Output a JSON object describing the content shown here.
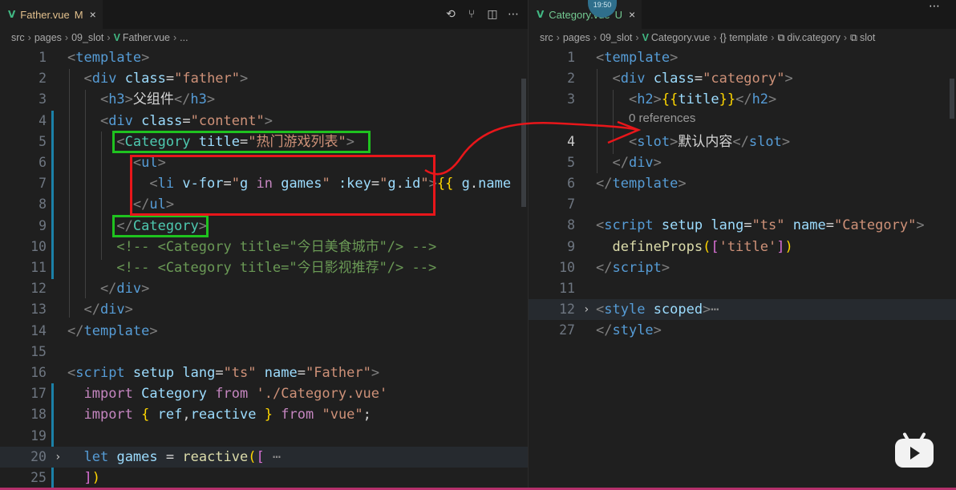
{
  "left": {
    "tab": {
      "label": "Father.vue",
      "status": "M",
      "close": "×"
    },
    "breadcrumb": [
      "src",
      "pages",
      "09_slot",
      "Father.vue",
      "..."
    ],
    "line_numbers": [
      "1",
      "2",
      "3",
      "4",
      "5",
      "6",
      "7",
      "8",
      "9",
      "10",
      "11",
      "12",
      "13",
      "14",
      "15",
      "16",
      "17",
      "18",
      "19",
      "20",
      "25"
    ],
    "lines": [
      [
        [
          "t-p",
          "<"
        ],
        [
          "t-tag",
          "template"
        ],
        [
          "t-p",
          ">"
        ]
      ],
      [
        [
          "t-p",
          "  <"
        ],
        [
          "t-tag",
          "div"
        ],
        [
          "t-txt",
          " "
        ],
        [
          "t-attr",
          "class"
        ],
        [
          "t-txt",
          "="
        ],
        [
          "t-str",
          "\"father\""
        ],
        [
          "t-p",
          ">"
        ]
      ],
      [
        [
          "t-p",
          "    <"
        ],
        [
          "t-tag",
          "h3"
        ],
        [
          "t-p",
          ">"
        ],
        [
          "t-txt",
          "父组件"
        ],
        [
          "t-p",
          "</"
        ],
        [
          "t-tag",
          "h3"
        ],
        [
          "t-p",
          ">"
        ]
      ],
      [
        [
          "t-p",
          "    <"
        ],
        [
          "t-tag",
          "div"
        ],
        [
          "t-txt",
          " "
        ],
        [
          "t-attr",
          "class"
        ],
        [
          "t-txt",
          "="
        ],
        [
          "t-str",
          "\"content\""
        ],
        [
          "t-p",
          ">"
        ]
      ],
      [
        [
          "t-p",
          "      <"
        ],
        [
          "t-cls",
          "Category"
        ],
        [
          "t-txt",
          " "
        ],
        [
          "t-attr",
          "title"
        ],
        [
          "t-txt",
          "="
        ],
        [
          "t-str",
          "\"热门游戏列表\""
        ],
        [
          "t-p",
          ">"
        ]
      ],
      [
        [
          "t-p",
          "        <"
        ],
        [
          "t-tag",
          "ul"
        ],
        [
          "t-p",
          ">"
        ]
      ],
      [
        [
          "t-p",
          "          <"
        ],
        [
          "t-tag",
          "li"
        ],
        [
          "t-txt",
          " "
        ],
        [
          "t-attr",
          "v-for"
        ],
        [
          "t-txt",
          "="
        ],
        [
          "t-str",
          "\""
        ],
        [
          "t-var",
          "g"
        ],
        [
          "t-txt",
          " "
        ],
        [
          "t-kw",
          "in"
        ],
        [
          "t-txt",
          " "
        ],
        [
          "t-var",
          "games"
        ],
        [
          "t-str",
          "\""
        ],
        [
          "t-txt",
          " "
        ],
        [
          "t-attr",
          ":key"
        ],
        [
          "t-txt",
          "="
        ],
        [
          "t-str",
          "\""
        ],
        [
          "t-var",
          "g"
        ],
        [
          "t-txt",
          "."
        ],
        [
          "t-var",
          "id"
        ],
        [
          "t-str",
          "\""
        ],
        [
          "t-p",
          ">"
        ],
        [
          "t-br",
          "{{"
        ],
        [
          "t-txt",
          " "
        ],
        [
          "t-var",
          "g"
        ],
        [
          "t-txt",
          "."
        ],
        [
          "t-var",
          "name"
        ]
      ],
      [
        [
          "t-p",
          "        </"
        ],
        [
          "t-tag",
          "ul"
        ],
        [
          "t-p",
          ">"
        ]
      ],
      [
        [
          "t-p",
          "      </"
        ],
        [
          "t-cls",
          "Category"
        ],
        [
          "t-p",
          ">"
        ]
      ],
      [
        [
          "t-com",
          "      <!-- <Category title=\"今日美食城市\"/> -->"
        ]
      ],
      [
        [
          "t-com",
          "      <!-- <Category title=\"今日影视推荐\"/> -->"
        ]
      ],
      [
        [
          "t-p",
          "    </"
        ],
        [
          "t-tag",
          "div"
        ],
        [
          "t-p",
          ">"
        ]
      ],
      [
        [
          "t-p",
          "  </"
        ],
        [
          "t-tag",
          "div"
        ],
        [
          "t-p",
          ">"
        ]
      ],
      [
        [
          "t-p",
          "</"
        ],
        [
          "t-tag",
          "template"
        ],
        [
          "t-p",
          ">"
        ]
      ],
      [
        [
          "t-txt",
          ""
        ]
      ],
      [
        [
          "t-p",
          "<"
        ],
        [
          "t-tag",
          "script"
        ],
        [
          "t-txt",
          " "
        ],
        [
          "t-attr",
          "setup"
        ],
        [
          "t-txt",
          " "
        ],
        [
          "t-attr",
          "lang"
        ],
        [
          "t-txt",
          "="
        ],
        [
          "t-str",
          "\"ts\""
        ],
        [
          "t-txt",
          " "
        ],
        [
          "t-attr",
          "name"
        ],
        [
          "t-txt",
          "="
        ],
        [
          "t-str",
          "\"Father\""
        ],
        [
          "t-p",
          ">"
        ]
      ],
      [
        [
          "t-txt",
          "  "
        ],
        [
          "t-kw",
          "import"
        ],
        [
          "t-txt",
          " "
        ],
        [
          "t-var",
          "Category"
        ],
        [
          "t-txt",
          " "
        ],
        [
          "t-kw",
          "from"
        ],
        [
          "t-txt",
          " "
        ],
        [
          "t-str",
          "'./Category.vue'"
        ]
      ],
      [
        [
          "t-txt",
          "  "
        ],
        [
          "t-kw",
          "import"
        ],
        [
          "t-txt",
          " "
        ],
        [
          "t-br",
          "{"
        ],
        [
          "t-txt",
          " "
        ],
        [
          "t-var",
          "ref"
        ],
        [
          "t-txt",
          ","
        ],
        [
          "t-var",
          "reactive"
        ],
        [
          "t-txt",
          " "
        ],
        [
          "t-br",
          "}"
        ],
        [
          "t-txt",
          " "
        ],
        [
          "t-kw",
          "from"
        ],
        [
          "t-txt",
          " "
        ],
        [
          "t-str",
          "\"vue\""
        ],
        [
          "t-txt",
          ";"
        ]
      ],
      [
        [
          "t-txt",
          ""
        ]
      ],
      [
        [
          "t-txt",
          "  "
        ],
        [
          "t-tag",
          "let"
        ],
        [
          "t-txt",
          " "
        ],
        [
          "t-var",
          "games"
        ],
        [
          "t-txt",
          " = "
        ],
        [
          "t-fn",
          "reactive"
        ],
        [
          "t-br",
          "("
        ],
        [
          "t-br2",
          "["
        ],
        [
          "t-dots",
          " ⋯"
        ]
      ],
      [
        [
          "t-txt",
          "  "
        ],
        [
          "t-br2",
          "]"
        ],
        [
          "t-br",
          ")"
        ]
      ]
    ]
  },
  "right": {
    "tab": {
      "label": "Category.vue",
      "status": "U",
      "close": "×"
    },
    "badge": "19:50",
    "breadcrumb": [
      "src",
      "pages",
      "09_slot",
      "Category.vue",
      "{} template",
      "div.category",
      "slot"
    ],
    "codelens": "0 references",
    "line_numbers": [
      "1",
      "2",
      "3",
      "4",
      "5",
      "6",
      "7",
      "8",
      "9",
      "10",
      "11",
      "12",
      "27"
    ],
    "lines": [
      [
        [
          "t-p",
          "<"
        ],
        [
          "t-tag",
          "template"
        ],
        [
          "t-p",
          ">"
        ]
      ],
      [
        [
          "t-p",
          "  <"
        ],
        [
          "t-tag",
          "div"
        ],
        [
          "t-txt",
          " "
        ],
        [
          "t-attr",
          "class"
        ],
        [
          "t-txt",
          "="
        ],
        [
          "t-str",
          "\"category\""
        ],
        [
          "t-p",
          ">"
        ]
      ],
      [
        [
          "t-p",
          "    <"
        ],
        [
          "t-tag",
          "h2"
        ],
        [
          "t-p",
          ">"
        ],
        [
          "t-br",
          "{{"
        ],
        [
          "t-var",
          "title"
        ],
        [
          "t-br",
          "}}"
        ],
        [
          "t-p",
          "</"
        ],
        [
          "t-tag",
          "h2"
        ],
        [
          "t-p",
          ">"
        ]
      ],
      [
        [
          "t-p",
          "    <"
        ],
        [
          "t-tag",
          "slot"
        ],
        [
          "t-p",
          ">"
        ],
        [
          "t-txt",
          "默认内容"
        ],
        [
          "t-p",
          "</"
        ],
        [
          "t-tag",
          "slot"
        ],
        [
          "t-p",
          ">"
        ]
      ],
      [
        [
          "t-p",
          "  </"
        ],
        [
          "t-tag",
          "div"
        ],
        [
          "t-p",
          ">"
        ]
      ],
      [
        [
          "t-p",
          "</"
        ],
        [
          "t-tag",
          "template"
        ],
        [
          "t-p",
          ">"
        ]
      ],
      [
        [
          "t-txt",
          ""
        ]
      ],
      [
        [
          "t-p",
          "<"
        ],
        [
          "t-tag",
          "script"
        ],
        [
          "t-txt",
          " "
        ],
        [
          "t-attr",
          "setup"
        ],
        [
          "t-txt",
          " "
        ],
        [
          "t-attr",
          "lang"
        ],
        [
          "t-txt",
          "="
        ],
        [
          "t-str",
          "\"ts\""
        ],
        [
          "t-txt",
          " "
        ],
        [
          "t-attr",
          "name"
        ],
        [
          "t-txt",
          "="
        ],
        [
          "t-str",
          "\"Category\""
        ],
        [
          "t-p",
          ">"
        ]
      ],
      [
        [
          "t-txt",
          "  "
        ],
        [
          "t-fn",
          "defineProps"
        ],
        [
          "t-br",
          "("
        ],
        [
          "t-br2",
          "["
        ],
        [
          "t-str",
          "'title'"
        ],
        [
          "t-br2",
          "]"
        ],
        [
          "t-br",
          ")"
        ]
      ],
      [
        [
          "t-p",
          "</"
        ],
        [
          "t-tag",
          "script"
        ],
        [
          "t-p",
          ">"
        ]
      ],
      [
        [
          "t-txt",
          ""
        ]
      ],
      [
        [
          "t-p",
          "<"
        ],
        [
          "t-tag",
          "style"
        ],
        [
          "t-txt",
          " "
        ],
        [
          "t-attr",
          "scoped"
        ],
        [
          "t-p",
          ">"
        ],
        [
          "t-dots",
          "⋯"
        ]
      ],
      [
        [
          "t-p",
          "</"
        ],
        [
          "t-tag",
          "style"
        ],
        [
          "t-p",
          ">"
        ]
      ]
    ]
  },
  "icons": [
    "vue-file-icon",
    "history-icon",
    "source-control-icon",
    "split-editor-icon",
    "more-actions-icon",
    "bilibili-tv-icon"
  ],
  "colors": {
    "green_box": "#1fc21f",
    "red_box": "#e8161a",
    "accent": "#41b883"
  }
}
